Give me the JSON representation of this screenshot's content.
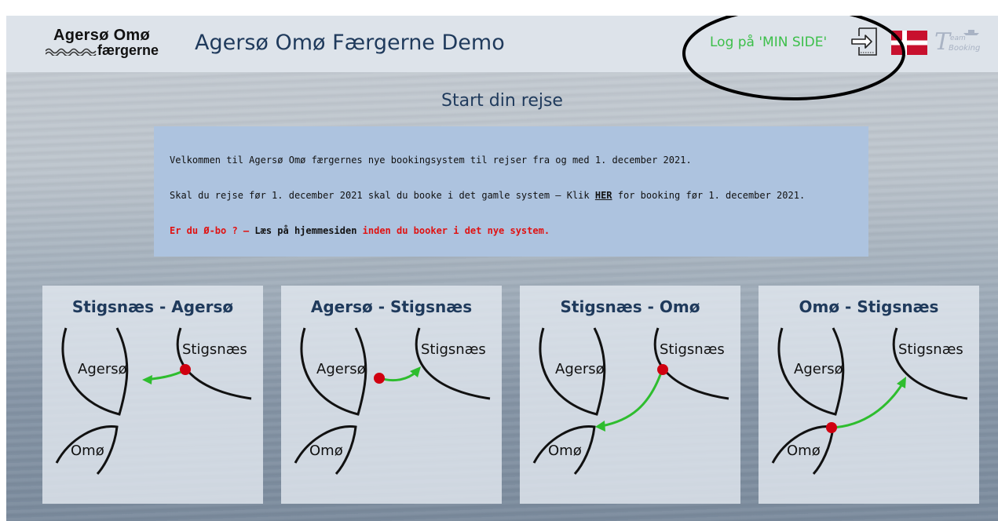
{
  "header": {
    "logo_line1": "Agersø Omø",
    "logo_line2": "færgerne",
    "title": "Agersø Omø Færgerne Demo",
    "login_label": "Log på 'MIN SIDE'",
    "partner_logo_T": "T",
    "partner_logo_team": "eam",
    "partner_logo_booking": "Booking"
  },
  "main": {
    "heading": "Start din rejse",
    "info": {
      "line1": "Velkommen til Agersø Omø færgernes nye bookingsystem til rejser fra og med 1. december 2021.",
      "line2_before": "Skal du rejse før 1. december 2021 skal du booke i det gamle system – Klik ",
      "line2_link": "HER",
      "line2_after": " for booking før 1. december 2021.",
      "line3_red1": "Er du Ø-bo ? – ",
      "line3_black": "Læs på hjemmesiden",
      "line3_red2": " inden du booker i det nye system."
    },
    "routes": [
      {
        "title": "Stigsnæs - Agersø",
        "label_agerso": "Agersø",
        "label_stigsnaes": "Stigsnæs",
        "label_omo": "Omø"
      },
      {
        "title": "Agersø - Stigsnæs",
        "label_agerso": "Agersø",
        "label_stigsnaes": "Stigsnæs",
        "label_omo": "Omø"
      },
      {
        "title": "Stigsnæs - Omø",
        "label_agerso": "Agersø",
        "label_stigsnaes": "Stigsnæs",
        "label_omo": "Omø"
      },
      {
        "title": "Omø - Stigsnæs",
        "label_agerso": "Agersø",
        "label_stigsnaes": "Stigsnæs",
        "label_omo": "Omø"
      }
    ]
  },
  "colors": {
    "title_blue": "#1f3a5c",
    "login_green": "#3cbf4a",
    "info_bg": "#adc3df",
    "alert_red": "#e01212",
    "flag_red": "#c8102e",
    "arrow_green": "#2ebd2e",
    "port_dot": "#d00010"
  },
  "icons": [
    "login-icon",
    "danish-flag-icon",
    "team-booking-logo"
  ]
}
